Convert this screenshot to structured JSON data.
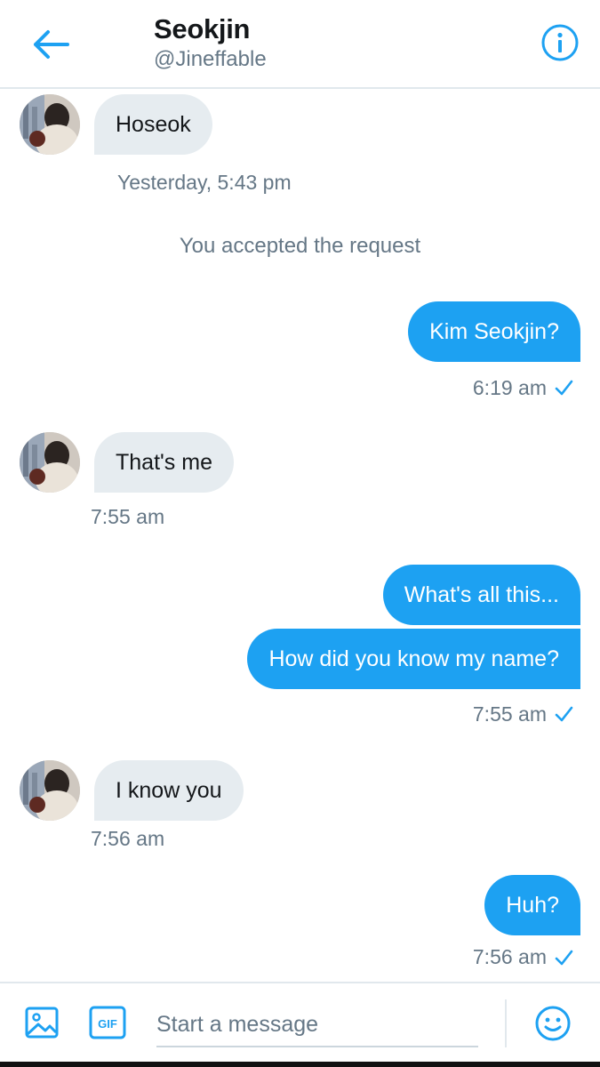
{
  "header": {
    "title": "Seokjin",
    "handle": "@Jineffable"
  },
  "messages": [
    {
      "side": "in",
      "text": "Hoseok"
    },
    {
      "side": "out",
      "text": "Kim Seokjin?"
    },
    {
      "side": "in",
      "text": "That's me"
    },
    {
      "side": "out",
      "text": "What's all this..."
    },
    {
      "side": "out",
      "text": "How did you know my name?"
    },
    {
      "side": "in",
      "text": "I know you"
    },
    {
      "side": "out",
      "text": "Huh?"
    }
  ],
  "timestamps": {
    "hoseok": "Yesterday, 5:43 pm",
    "kim": "6:19 am",
    "thats_me": "7:55 am",
    "name": "7:55 am",
    "know": "7:56 am",
    "huh": "7:56 am"
  },
  "system_note": "You accepted the request",
  "composer": {
    "placeholder": "Start a message",
    "gif_label": "GIF"
  },
  "colors": {
    "accent": "#1da1f2",
    "incoming_bubble": "#e6ecf0",
    "secondary_text": "#657786"
  },
  "icons": {
    "back": "arrow-left-icon",
    "info": "info-icon",
    "image": "image-icon",
    "gif": "gif-icon",
    "emoji": "emoji-icon",
    "read": "checkmark-icon"
  }
}
